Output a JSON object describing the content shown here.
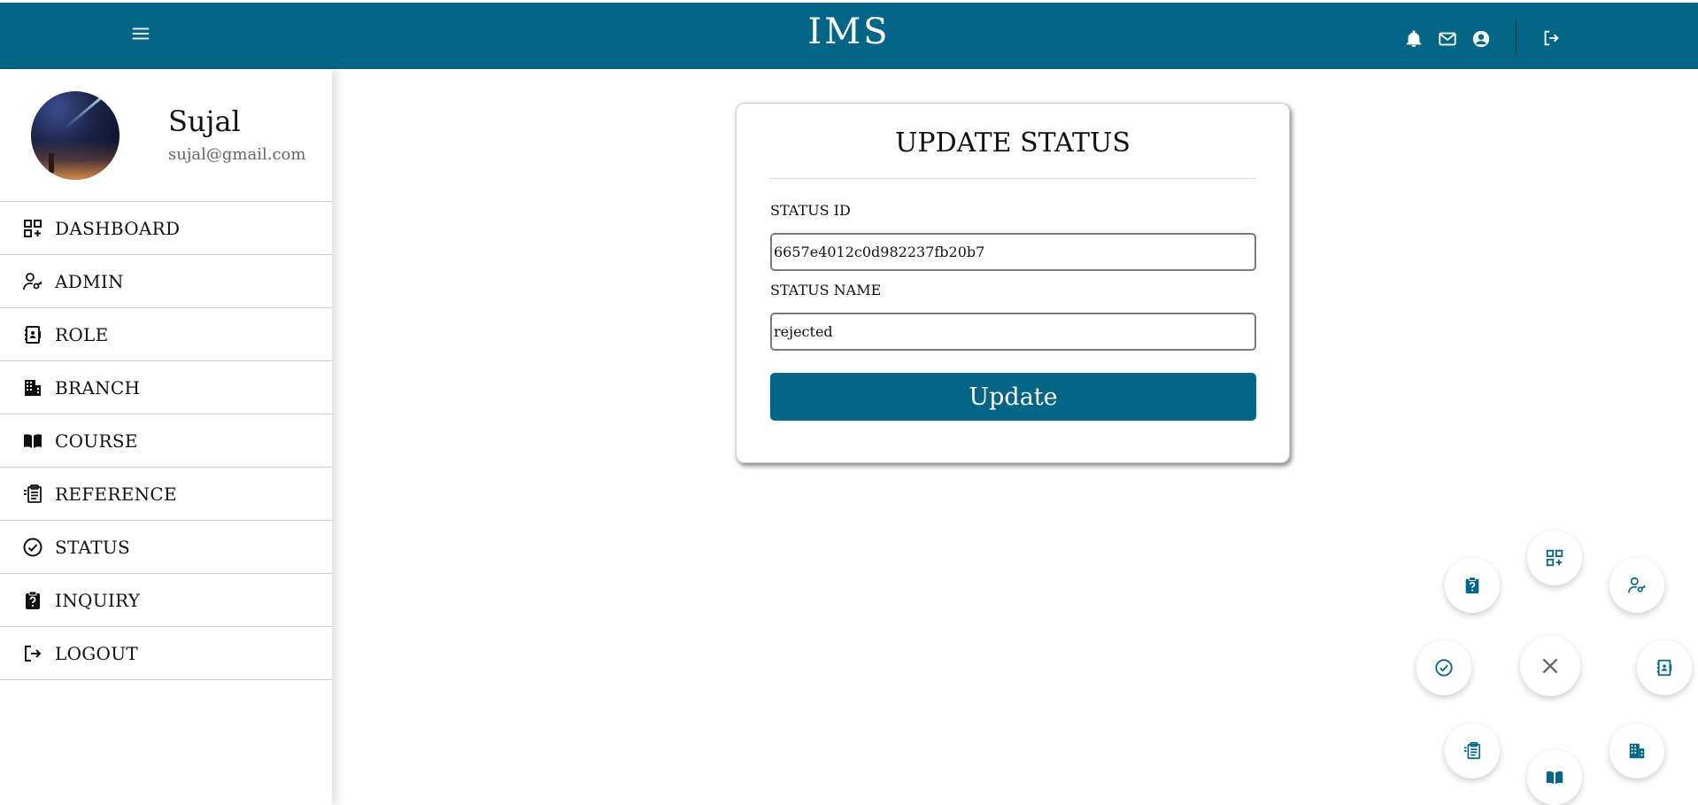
{
  "header": {
    "brand": "IMS",
    "color": "#046687"
  },
  "profile": {
    "name": "Sujal",
    "email": "sujal@gmail.com"
  },
  "sidebar": {
    "items": [
      {
        "label": "DASHBOARD",
        "icon": "dashboard-icon"
      },
      {
        "label": "ADMIN",
        "icon": "admin-key-icon"
      },
      {
        "label": "ROLE",
        "icon": "contact-book-icon"
      },
      {
        "label": "BRANCH",
        "icon": "building-icon"
      },
      {
        "label": "COURSE",
        "icon": "book-icon"
      },
      {
        "label": "REFERENCE",
        "icon": "clipboard-list-icon"
      },
      {
        "label": "STATUS",
        "icon": "check-circle-icon"
      },
      {
        "label": "INQUIRY",
        "icon": "clipboard-question-icon"
      },
      {
        "label": "LOGOUT",
        "icon": "logout-icon"
      }
    ]
  },
  "form": {
    "title": "UPDATE STATUS",
    "status_id_label": "STATUS ID",
    "status_id_value": "6657e4012c0d982237fb20b7",
    "status_name_label": "STATUS NAME",
    "status_name_value": "rejected",
    "submit_label": "Update"
  }
}
